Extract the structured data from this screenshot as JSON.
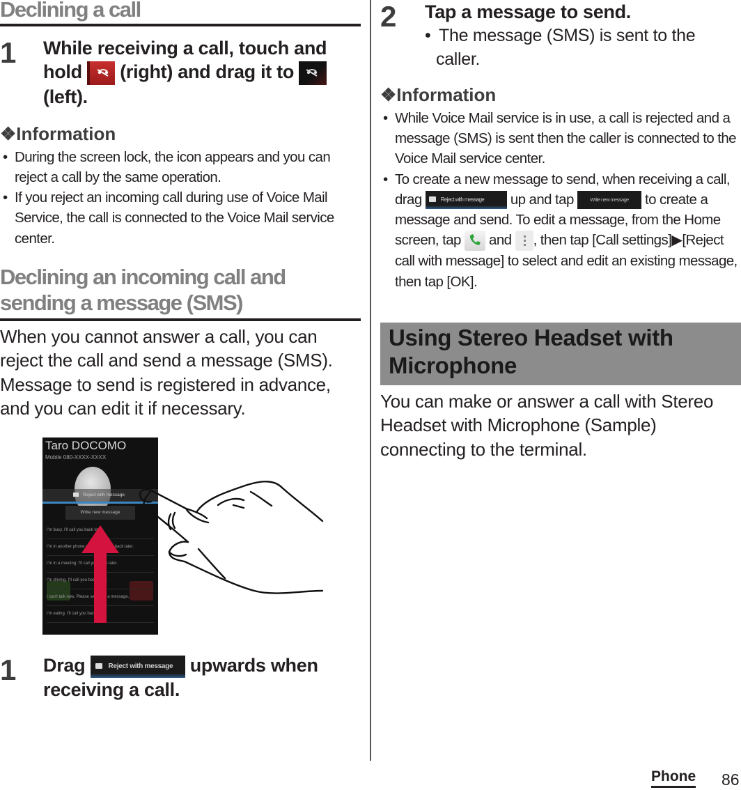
{
  "left": {
    "section1": {
      "title": "Declining a call",
      "step": {
        "number": "1",
        "text_a": "While receiving a call, touch and hold",
        "text_b": "(right) and drag it to",
        "text_c": "(left).",
        "icon_from": "end-call-icon-red",
        "icon_to": "end-call-icon-dark"
      },
      "info": {
        "heading": "❖Information",
        "items": [
          "During the screen lock, the icon appears and you can reject a call by the same operation.",
          "If you reject an incoming call during use of Voice Mail Service, the call is connected to the Voice Mail service center."
        ]
      }
    },
    "section2": {
      "title_line1": "Declining an incoming call and",
      "title_line2": "sending a message (SMS)",
      "intro": "When you cannot answer a call, you can reject the call and send a message (SMS). Message to send is registered in advance, and you can edit it if necessary.",
      "screenshot": {
        "caller_name": "Taro DOCOMO",
        "caller_number": "Mobile 080-XXXX-XXXX",
        "reject_label": "Reject with message",
        "write_label": "Write new message",
        "messages": [
          "I'm busy. I'll call you back later.",
          "I'm in another phone call. I'll call you back later.",
          "I'm in a meeting. I'll call you back later.",
          "I'm driving. I'll call you back later.",
          "I can't talk now. Please send me a message.",
          "I'm eating. I'll call you back later."
        ],
        "arrow_color": "#d4143f"
      },
      "step": {
        "number": "1",
        "text_a": "Drag",
        "chip": "Reject with message",
        "text_b": "upwards when receiving a call."
      }
    }
  },
  "right": {
    "step2": {
      "number": "2",
      "text": "Tap a message to send.",
      "bullet": "The message (SMS) is sent to the caller."
    },
    "info": {
      "heading": "❖Information",
      "item1": "While Voice Mail service is in use, a call is rejected and a message (SMS) is sent then the caller is connected to the Voice Mail service center.",
      "item2": {
        "a": "To create a new message to send, when receiving a call, drag",
        "chip_reject": "Reject with message",
        "b": "up and tap",
        "chip_write": "Write new message",
        "c": "to create a message and send. To edit a message, from the Home screen, tap",
        "d": "and",
        "e": ", then tap [Call settings]▶[Reject call with message] to select and edit an existing message, then tap [OK]."
      }
    },
    "headset": {
      "title_line1": "Using Stereo Headset with",
      "title_line2": "Microphone",
      "body": "You can make or answer a call with Stereo Headset with Microphone (Sample) connecting to the terminal."
    }
  },
  "footer": {
    "section_label": "Phone",
    "page_number": "86"
  },
  "colors": {
    "heading_gray": "#808080",
    "headset_bar": "#8c8c8c",
    "arrow_red": "#d4143f",
    "end_call_red": "#b32424"
  }
}
